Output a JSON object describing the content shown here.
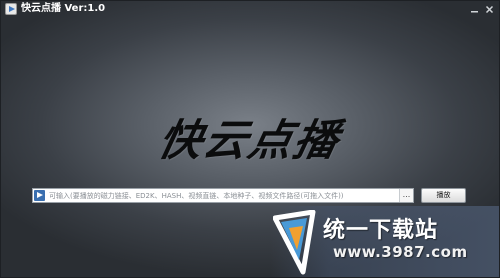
{
  "window": {
    "title": "快云点播 Ver:1.0",
    "minimize_icon": "minimize-icon",
    "close_icon": "close-icon"
  },
  "main": {
    "logo_text": "快云点播"
  },
  "input_bar": {
    "placeholder": "可输入(要播放的磁力链接、ED2K、HASH、视频直链、本地种子、视频文件路径(可拖入文件))",
    "value": "",
    "browse_label": "...",
    "play_label": "播放"
  },
  "watermark": {
    "title": "统一下载站",
    "url": "www.3987.com"
  },
  "colors": {
    "background": "#4a5057",
    "logo": "#0b0c0d",
    "accent": "#3a6fb0"
  }
}
